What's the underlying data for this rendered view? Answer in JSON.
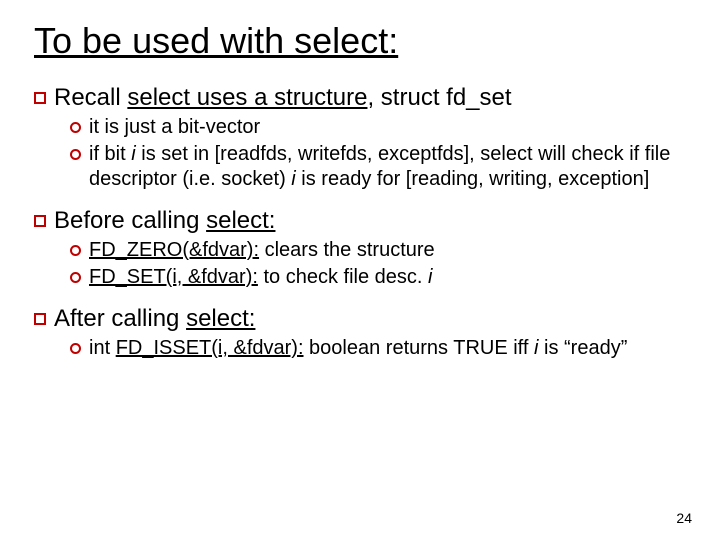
{
  "title": "To be used with select:",
  "b1": {
    "pre": "Recall ",
    "mid": "select uses a structure",
    "suf": ", struct fd_set",
    "s1": "it is just a bit-vector",
    "s2a": "if bit ",
    "s2b": " is set in [readfds, writefds, exceptfds], select will check if file descriptor (i.e. socket) ",
    "s2c": " is ready for [reading, writing, exception]"
  },
  "b2": {
    "pre": "Before calling ",
    "suf": "select:",
    "s1a": "FD_ZERO(&fdvar):",
    "s1b": " clears the structure",
    "s2a": "FD_SET(i, &fdvar):",
    "s2b": " to check file desc. "
  },
  "b3": {
    "pre": "After calling ",
    "suf": "select:",
    "s1a": "int ",
    "s1b": "FD_ISSET(i, &fdvar):",
    "s1c": " boolean returns TRUE iff ",
    "s1d": " is “ready”"
  },
  "i": "i",
  "pagenum": "24"
}
